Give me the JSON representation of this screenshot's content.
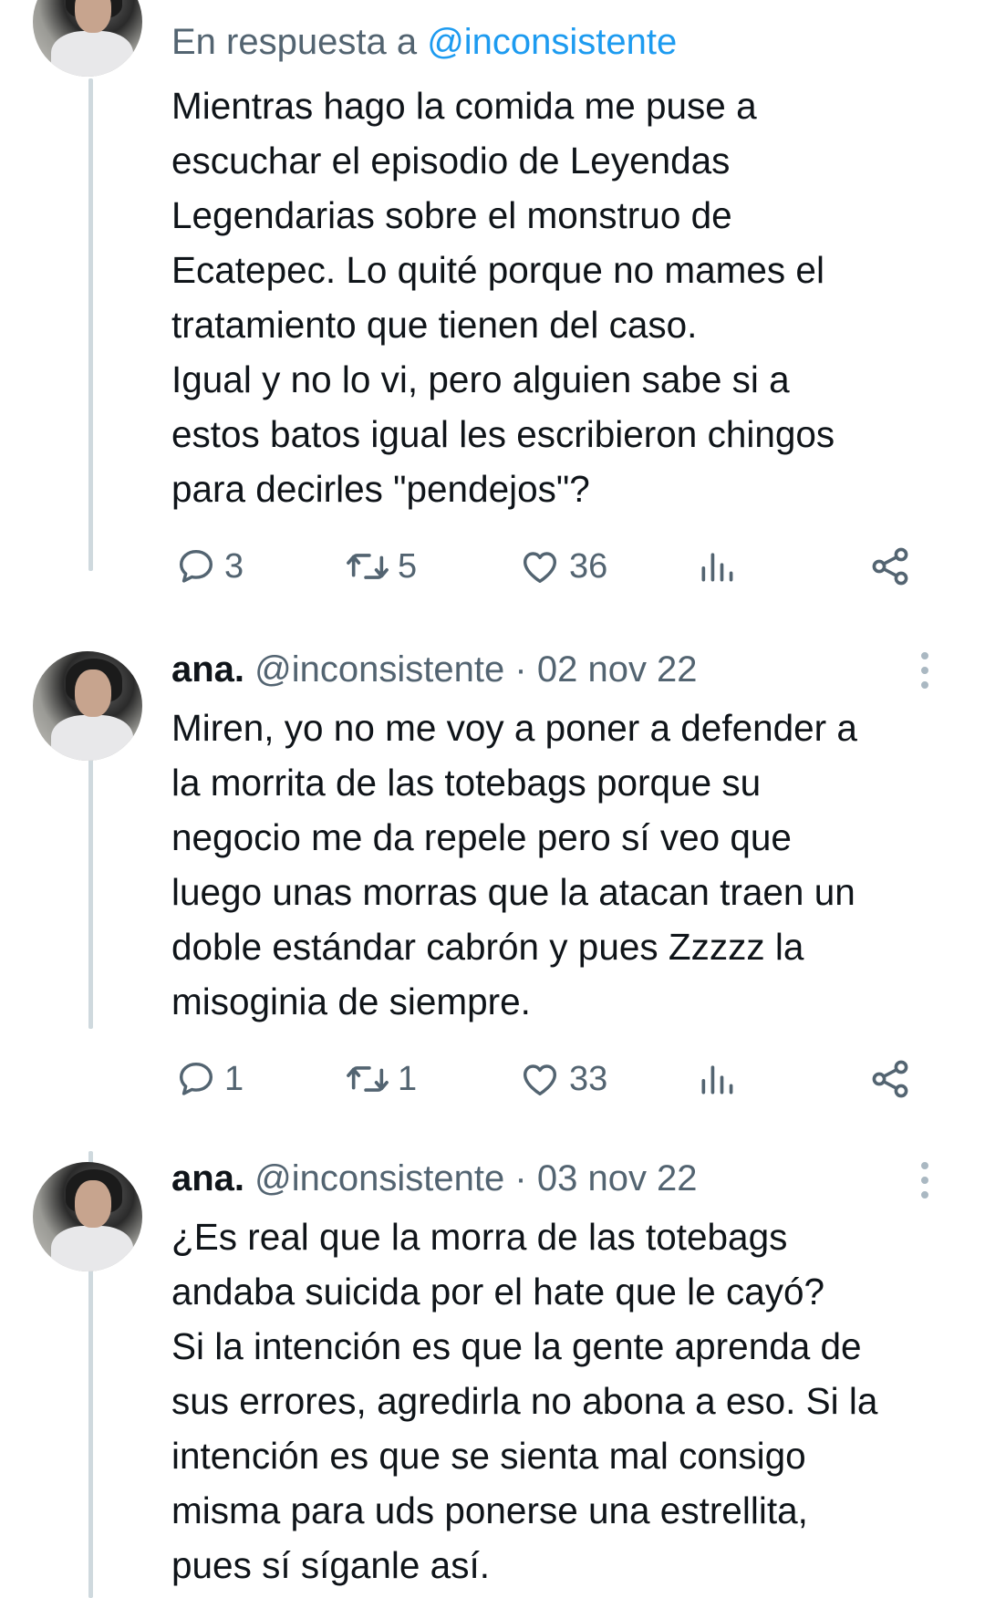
{
  "tweets": [
    {
      "reply_prefix": "En respuesta a ",
      "reply_mention": "@inconsistente",
      "text": "Mientras hago la comida me puse a\nescuchar el episodio de Leyendas\nLegendarias sobre el monstruo de\nEcatepec. Lo quité porque no mames el\ntratamiento que tienen del caso.\nIgual y no lo vi, pero alguien sabe si a\nestos batos igual les escribieron chingos\npara decirles \"pendejos\"?",
      "stats": {
        "replies": "3",
        "retweets": "5",
        "likes": "36"
      }
    },
    {
      "name": "ana.",
      "handle": "@inconsistente",
      "separator": "·",
      "date": "02 nov 22",
      "text": "Miren, yo no me voy a poner a defender a\nla morrita de las totebags porque su\nnegocio me da repele pero sí veo que\nluego unas morras que la atacan traen un\ndoble estándar cabrón y pues Zzzzz la\nmisoginia de siempre.",
      "stats": {
        "replies": "1",
        "retweets": "1",
        "likes": "33"
      }
    },
    {
      "name": "ana.",
      "handle": "@inconsistente",
      "separator": "·",
      "date": "03 nov 22",
      "text": "¿Es real que la morra de las totebags\nandaba suicida por el hate que le cayó?\nSi la intención es que la gente aprenda de\nsus errores, agredirla no abona a eso. Si la\nintención es que se sienta mal consigo\nmisma para uds ponerse una estrellita,\npues sí síganle así."
    }
  ],
  "icons": {
    "reply": "reply-icon",
    "retweet": "retweet-icon",
    "like": "heart-icon",
    "views": "views-icon",
    "share": "share-icon",
    "more": "more-icon"
  },
  "colors": {
    "accent": "#1d9bf0",
    "secondary_text": "#536471",
    "thread_line": "#cfd9de"
  }
}
